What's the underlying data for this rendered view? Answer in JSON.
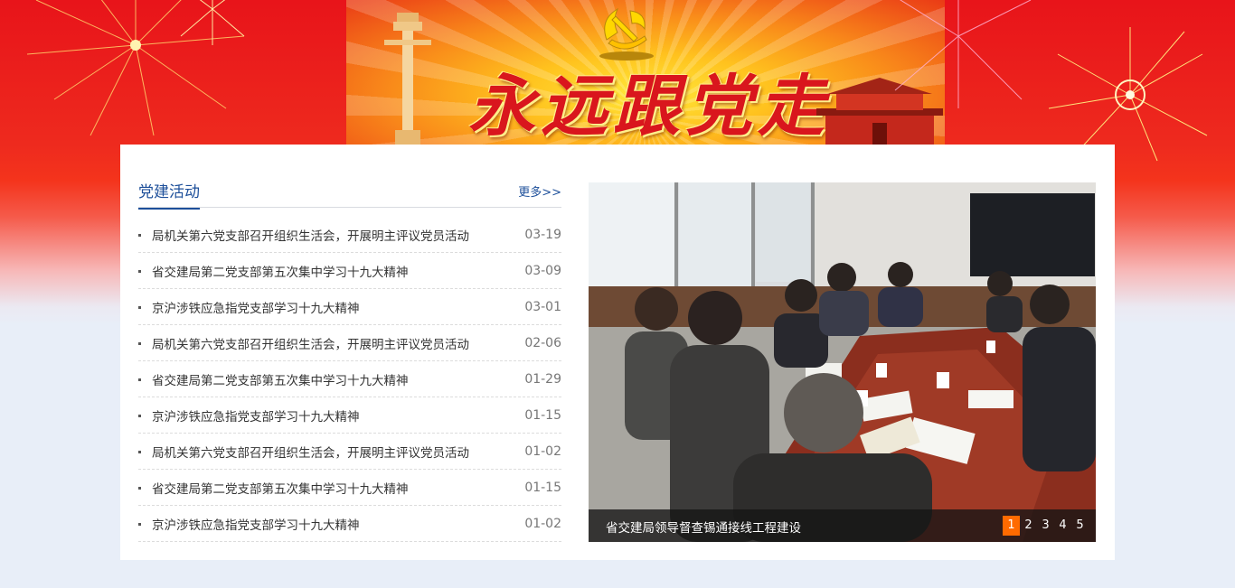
{
  "banner": {
    "slogan": "永远跟党走"
  },
  "news": {
    "title": "党建活动",
    "more_label": "更多>>",
    "items": [
      {
        "title": "局机关第六党支部召开组织生活会，开展明主评议党员活动",
        "date": "03-19"
      },
      {
        "title": "省交建局第二党支部第五次集中学习十九大精神",
        "date": "03-09"
      },
      {
        "title": "京沪涉铁应急指党支部学习十九大精神",
        "date": "03-01"
      },
      {
        "title": "局机关第六党支部召开组织生活会，开展明主评议党员活动",
        "date": "02-06"
      },
      {
        "title": "省交建局第二党支部第五次集中学习十九大精神",
        "date": "01-29"
      },
      {
        "title": "京沪涉铁应急指党支部学习十九大精神",
        "date": "01-15"
      },
      {
        "title": "局机关第六党支部召开组织生活会，开展明主评议党员活动",
        "date": "01-02"
      },
      {
        "title": "省交建局第二党支部第五次集中学习十九大精神",
        "date": "01-15"
      },
      {
        "title": "京沪涉铁应急指党支部学习十九大精神",
        "date": "01-02"
      }
    ]
  },
  "slideshow": {
    "caption": "省交建局领导督查锡通接线工程建设",
    "pages": [
      "1",
      "2",
      "3",
      "4",
      "5"
    ],
    "active_page": "1"
  },
  "colors": {
    "accent": "#1d4f9a",
    "pager_active": "#ff6a00",
    "banner_red": "#e8141a"
  }
}
